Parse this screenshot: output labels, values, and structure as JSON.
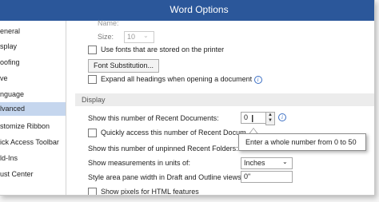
{
  "window": {
    "title": "Word Options"
  },
  "sidebar": {
    "items": [
      {
        "label": "eneral",
        "active": false
      },
      {
        "label": "splay",
        "active": false
      },
      {
        "label": "oofing",
        "active": false
      },
      {
        "label": "ve",
        "active": false
      },
      {
        "label": "nguage",
        "active": false
      },
      {
        "label": "lvanced",
        "active": true
      },
      {
        "label": "stomize Ribbon",
        "active": false
      },
      {
        "label": "ick Access Toolbar",
        "active": false
      },
      {
        "label": "ld-Ins",
        "active": false
      },
      {
        "label": "ust Center",
        "active": false
      }
    ]
  },
  "main": {
    "font_name_label": "Name:",
    "size_label": "Size:",
    "size_value": "10",
    "use_printer_fonts": "Use fonts that are stored on the printer",
    "font_substitution_button": "Font Substitution...",
    "expand_headings": "Expand all headings when opening a document",
    "display_header": "Display",
    "recent_docs_label": "Show this number of Recent Documents:",
    "recent_docs_value": "0",
    "quick_access_label": "Quickly access this number of Recent Docum",
    "unpinned_folders_label": "Show this number of unpinned Recent Folders:",
    "measurements_label": "Show measurements in units of:",
    "measurements_value": "Inches",
    "style_area_label": "Style area pane width in Draft and Outline views:",
    "style_area_value": "0\"",
    "show_pixels_label": "Show pixels for HTML features"
  },
  "tooltip": {
    "text": "Enter a whole number from 0 to 50"
  }
}
